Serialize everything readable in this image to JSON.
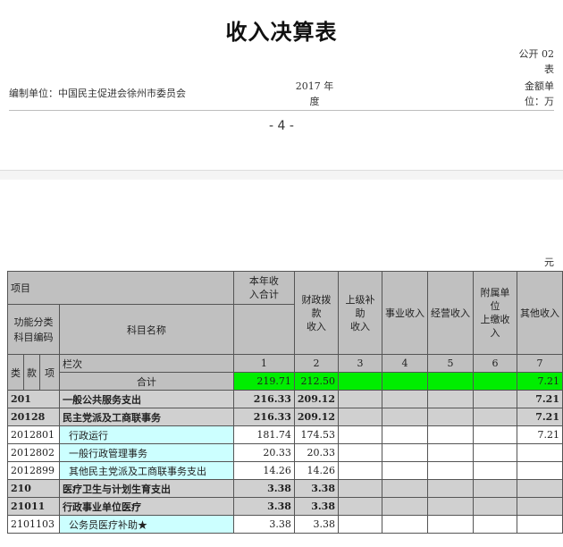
{
  "header": {
    "title": "收入决算表",
    "form_code": "公开 02",
    "form_code_line2": "表",
    "org": "编制单位：中国民主促进会徐州市委员会",
    "year": "2017 年",
    "year_line2": "度",
    "unit": "金额单",
    "unit_line2": "位：万",
    "page": "- 4 -",
    "unit_right": "元"
  },
  "table": {
    "h_item": "项目",
    "h_total": "本年收入合计",
    "h_total_l1": "本年收",
    "h_total_l2": "入合计",
    "h_fiscal_l1": "财政拨款",
    "h_fiscal_l2": "收入",
    "h_upper_l1": "上级补助",
    "h_upper_l2": "收入",
    "h_business": "事业收入",
    "h_operating": "经营收入",
    "h_affiliate_l1": "附属单位",
    "h_affiliate_l2": "上缴收入",
    "h_other": "其他收入",
    "h_func_l1": "功能分类",
    "h_func_l2": "科目编码",
    "h_subject": "科目名称",
    "h_lei": "类",
    "h_kuan": "款",
    "h_xiang": "项",
    "h_lanci": "栏次",
    "col_nums": [
      "1",
      "2",
      "3",
      "4",
      "5",
      "6",
      "7"
    ],
    "sum_label": "合计",
    "sum_total": "219.71",
    "sum_fiscal": "212.50",
    "sum_other": "7.21",
    "rows": [
      {
        "code": "201",
        "name": "一般公共服务支出",
        "total": "216.33",
        "fiscal": "209.12",
        "other": "7.21",
        "bold": true
      },
      {
        "code": "20128",
        "name": "民主党派及工商联事务",
        "total": "216.33",
        "fiscal": "209.12",
        "other": "7.21",
        "bold": true
      },
      {
        "code": "2012801",
        "name": "行政运行",
        "total": "181.74",
        "fiscal": "174.53",
        "other": "7.21",
        "bold": false
      },
      {
        "code": "2012802",
        "name": "一般行政管理事务",
        "total": "20.33",
        "fiscal": "20.33",
        "other": "",
        "bold": false
      },
      {
        "code": "2012899",
        "name": "其他民主党派及工商联事务支出",
        "total": "14.26",
        "fiscal": "14.26",
        "other": "",
        "bold": false
      },
      {
        "code": "210",
        "name": "医疗卫生与计划生育支出",
        "total": "3.38",
        "fiscal": "3.38",
        "other": "",
        "bold": true
      },
      {
        "code": "21011",
        "name": "行政事业单位医疗",
        "total": "3.38",
        "fiscal": "3.38",
        "other": "",
        "bold": true
      },
      {
        "code": "2101103",
        "name": "公务员医疗补助★",
        "total": "3.38",
        "fiscal": "3.38",
        "other": "",
        "bold": false
      }
    ]
  },
  "colors": {
    "highlight_green": "#00ee00",
    "subject_cyan": "#ccffff",
    "header_gray": "#c0c0c0"
  }
}
